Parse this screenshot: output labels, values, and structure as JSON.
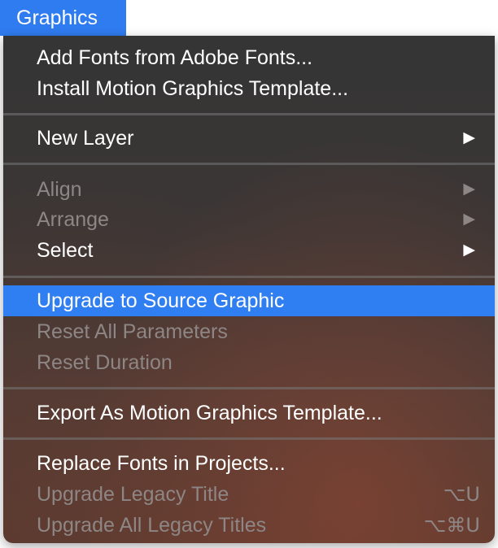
{
  "menubar": {
    "title": "Graphics"
  },
  "menu": {
    "items": [
      {
        "label": "Add Fonts from Adobe Fonts..."
      },
      {
        "label": "Install Motion Graphics Template..."
      },
      {
        "label": "New Layer",
        "submenu_arrow": "▶"
      },
      {
        "label": "Align",
        "submenu_arrow": "▶",
        "enabled": false
      },
      {
        "label": "Arrange",
        "submenu_arrow": "▶",
        "enabled": false
      },
      {
        "label": "Select",
        "submenu_arrow": "▶"
      },
      {
        "label": "Upgrade to Source Graphic",
        "highlighted": true
      },
      {
        "label": "Reset All Parameters",
        "enabled": false
      },
      {
        "label": "Reset Duration",
        "enabled": false
      },
      {
        "label": "Export As Motion Graphics Template..."
      },
      {
        "label": "Replace Fonts in Projects..."
      },
      {
        "label": "Upgrade Legacy Title",
        "shortcut": "⌥U",
        "enabled": false
      },
      {
        "label": "Upgrade All Legacy Titles",
        "shortcut": "⌥⌘U",
        "enabled": false
      }
    ]
  },
  "colors": {
    "highlight": "#2f7ff2",
    "menubar_title_bg": "#2f7cf0",
    "enabled_text": "#ffffff",
    "disabled_text": "#8d8685"
  }
}
